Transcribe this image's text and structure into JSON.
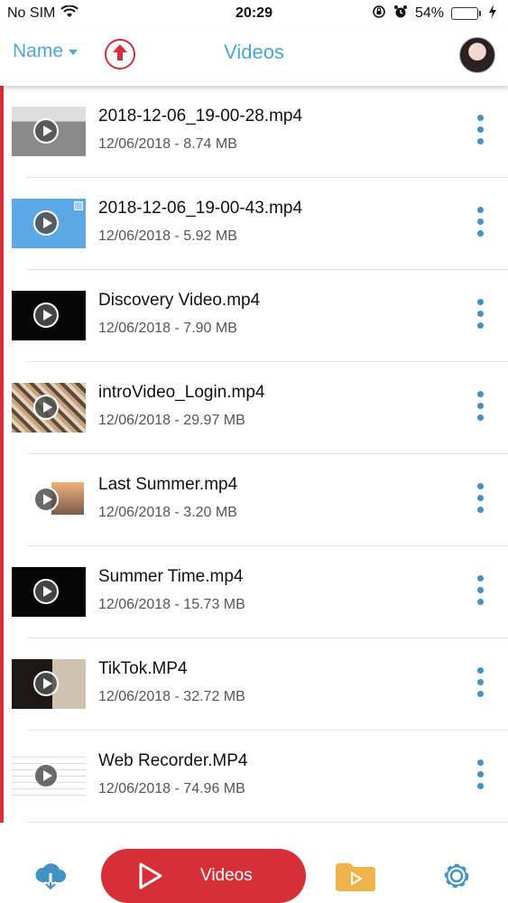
{
  "status_bar": {
    "carrier": "No SIM",
    "time": "20:29",
    "battery_percent": "54%",
    "battery_level": 0.54,
    "icons": [
      "wifi-icon",
      "rotation-lock-icon",
      "alarm-icon",
      "battery-icon",
      "charging-icon"
    ]
  },
  "header": {
    "sort_label": "Name",
    "title": "Videos",
    "icons": [
      "sort-caret-icon",
      "upload-arrow-icon",
      "avatar"
    ]
  },
  "videos": [
    {
      "name": "2018-12-06_19-00-28.mp4",
      "meta": "12/06/2018 - 8.74 MB"
    },
    {
      "name": "2018-12-06_19-00-43.mp4",
      "meta": "12/06/2018 - 5.92 MB"
    },
    {
      "name": "Discovery Video.mp4",
      "meta": "12/06/2018 - 7.90 MB"
    },
    {
      "name": "introVideo_Login.mp4",
      "meta": "12/06/2018 - 29.97 MB"
    },
    {
      "name": "Last Summer.mp4",
      "meta": "12/06/2018 - 3.20 MB"
    },
    {
      "name": "Summer Time.mp4",
      "meta": "12/06/2018 - 15.73 MB"
    },
    {
      "name": "TikTok.MP4",
      "meta": "12/06/2018 - 32.72 MB"
    },
    {
      "name": "Web Recorder.MP4",
      "meta": "12/06/2018 - 74.96 MB"
    }
  ],
  "bottom_bar": {
    "active_label": "Videos",
    "icons": [
      "cloud-download-icon",
      "play-icon",
      "folder-play-icon",
      "settings-gear-icon"
    ]
  },
  "colors": {
    "accent_blue": "#4aa8d8",
    "accent_red": "#d62f37",
    "menu_dots": "#3f93c6",
    "folder_orange": "#f0b24a",
    "battery_green": "#34c759"
  }
}
